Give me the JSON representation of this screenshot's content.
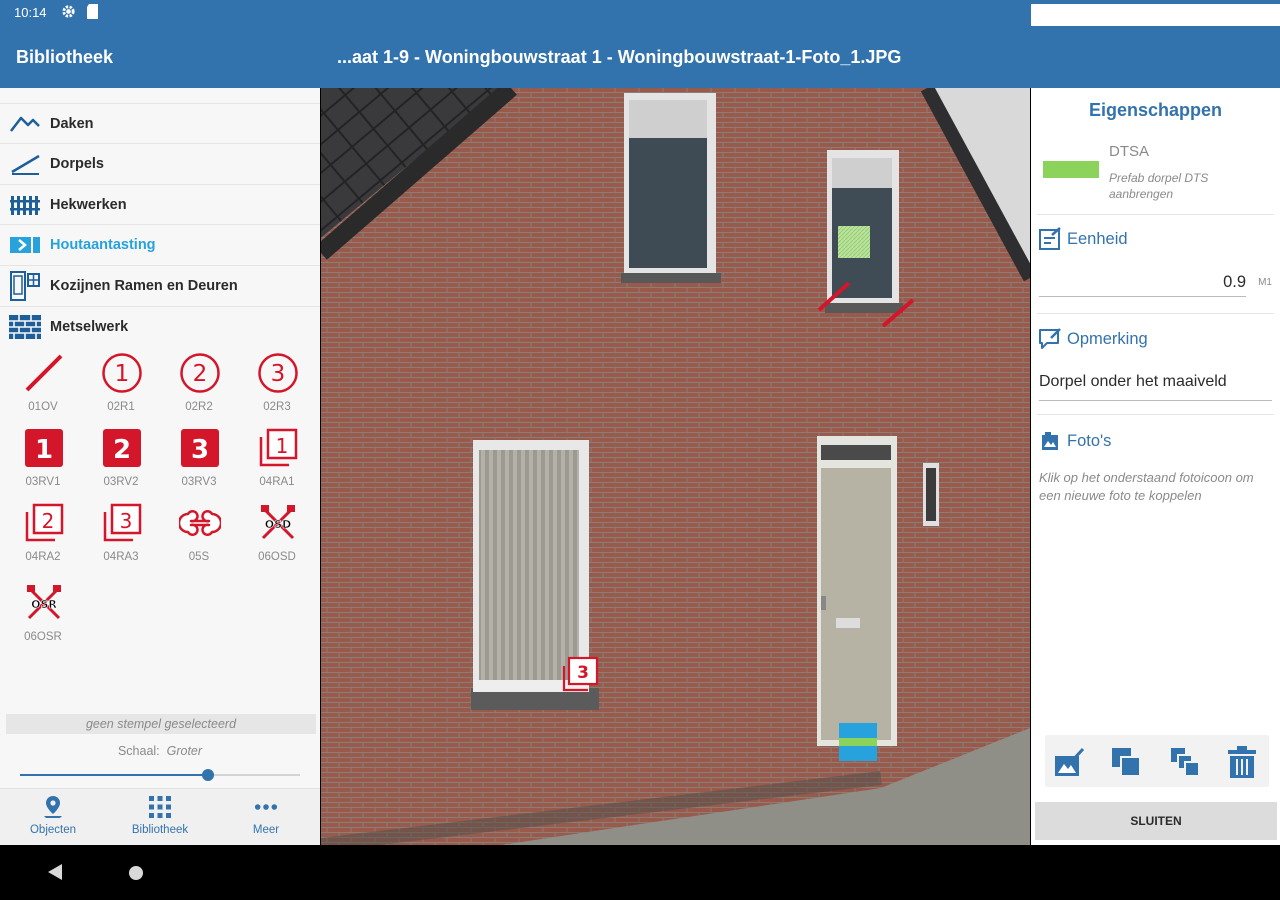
{
  "status_bar": {
    "time": "10:14",
    "icons": [
      "gear-icon",
      "sd-card-icon",
      "wifi-icon",
      "signal-icon",
      "battery-icon"
    ]
  },
  "title_bar": {
    "library": "Bibliotheek",
    "document": "...aat 1-9 - Woningbouwstraat 1 - Woningbouwstraat-1-Foto_1.JPG"
  },
  "categories": [
    {
      "label": "Daken",
      "icon": "roof-icon",
      "active": false
    },
    {
      "label": "Dorpels",
      "icon": "sill-icon",
      "active": false
    },
    {
      "label": "Hekwerken",
      "icon": "fence-icon",
      "active": false
    },
    {
      "label": "Houtaantasting",
      "icon": "wood-decay-icon",
      "active": true
    },
    {
      "label": "Kozijnen Ramen en Deuren",
      "icon": "window-frame-icon",
      "active": false
    },
    {
      "label": "Metselwerk",
      "icon": "brick-wall-icon",
      "active": false
    }
  ],
  "stamps": [
    {
      "code": "01OV",
      "glyph": ""
    },
    {
      "code": "02R1",
      "glyph": "1"
    },
    {
      "code": "02R2",
      "glyph": "2"
    },
    {
      "code": "02R3",
      "glyph": "3"
    },
    {
      "code": "03RV1",
      "glyph": "1"
    },
    {
      "code": "03RV2",
      "glyph": "2"
    },
    {
      "code": "03RV3",
      "glyph": "3"
    },
    {
      "code": "04RA1",
      "glyph": "1"
    },
    {
      "code": "04RA2",
      "glyph": "2"
    },
    {
      "code": "04RA3",
      "glyph": "3"
    },
    {
      "code": "05S",
      "glyph": ""
    },
    {
      "code": "06OSD",
      "glyph": "OSD"
    },
    {
      "code": "06OSR",
      "glyph": "OSR"
    }
  ],
  "stamp_status": "geen stempel geselecteerd",
  "scale": {
    "label": "Schaal:",
    "value": "Groter",
    "fraction": 0.67
  },
  "bottom_nav": [
    {
      "label": "Objecten",
      "icon": "map-pin-icon"
    },
    {
      "label": "Bibliotheek",
      "icon": "grid-icon"
    },
    {
      "label": "Meer",
      "icon": "more-icon"
    }
  ],
  "properties": {
    "title": "Eigenschappen",
    "color": "#8bd35a",
    "code": "DTSA",
    "description": "Prefab dorpel DTS aanbrengen",
    "unit_section": "Eenheid",
    "value": "0.9",
    "unit": "M1",
    "remark_section": "Opmerking",
    "remark": "Dorpel onder het maaiveld",
    "photos_section": "Foto's",
    "photos_hint": "Klik op het onderstaand fotoicoon om een nieuwe foto te koppelen",
    "close_button": "SLUITEN"
  },
  "photo_overlay": {
    "stamp_glyph": "3"
  },
  "colors": {
    "primary": "#3373ad",
    "accent": "#27a2dd",
    "stamp_red": "#d3162a"
  }
}
